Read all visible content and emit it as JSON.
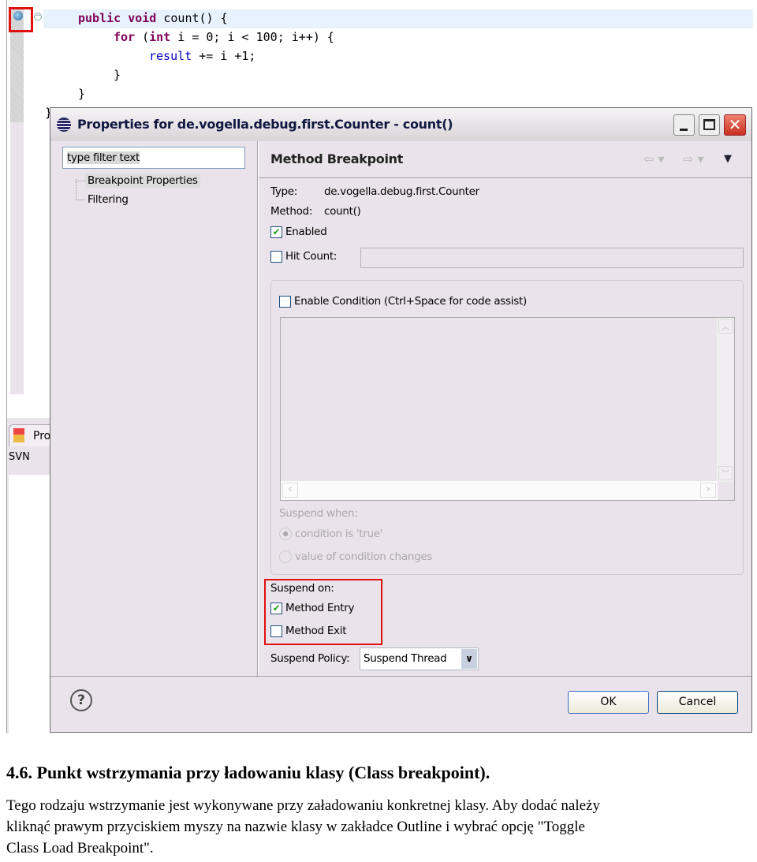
{
  "editor": {
    "lines": [
      {
        "parts": [
          {
            "t": "public",
            "k": "kw"
          },
          {
            "t": " "
          },
          {
            "t": "void",
            "k": "kw"
          },
          {
            "t": " count() {"
          }
        ]
      },
      {
        "parts": [
          {
            "t": "for",
            "k": "kw"
          },
          {
            "t": " ("
          },
          {
            "t": "int",
            "k": "kw"
          },
          {
            "t": " i = 0; i < 100; i++) {"
          }
        ]
      },
      {
        "parts": [
          {
            "t": "result",
            "k": "fld"
          },
          {
            "t": " += i +1;"
          }
        ]
      },
      {
        "parts": [
          {
            "t": "}"
          }
        ]
      },
      {
        "parts": [
          {
            "t": "}"
          }
        ]
      },
      {
        "parts": [
          {
            "t": "}"
          }
        ]
      }
    ],
    "breakpoint_icon": "method-breakpoint-icon"
  },
  "side_view": {
    "tab_label": "Pro",
    "svn_label": "SVN"
  },
  "dialog": {
    "title": "Properties for de.vogella.debug.first.Counter - count()",
    "filter_placeholder": "type filter text",
    "tree": [
      "Breakpoint Properties",
      "Filtering"
    ],
    "page_title": "Method Breakpoint",
    "type_label": "Type:",
    "type_value": "de.vogella.debug.first.Counter",
    "method_label": "Method:",
    "method_value": "count()",
    "enabled_label": "Enabled",
    "enabled": true,
    "hit_count_label": "Hit Count:",
    "hit_count": false,
    "hit_count_value": "",
    "enable_condition_label": "Enable Condition (Ctrl+Space for code assist)",
    "enable_condition": false,
    "suspend_when_label": "Suspend when:",
    "suspend_when_options": [
      "condition is 'true'",
      "value of condition changes"
    ],
    "suspend_on_label": "Suspend on:",
    "method_entry_label": "Method Entry",
    "method_entry": true,
    "method_exit_label": "Method Exit",
    "method_exit": false,
    "suspend_policy_label": "Suspend Policy:",
    "suspend_policy_value": "Suspend Thread",
    "ok_label": "OK",
    "cancel_label": "Cancel",
    "highlight_color": "#e01010"
  },
  "doc": {
    "heading": "4.6.  Punkt wstrzymania przy ładowaniu klasy (Class breakpoint).",
    "lines": [
      "Tego rodzaju wstrzymanie jest wykonywane przy załadowaniu konkretnej klasy. Aby dodać należy",
      "kliknąć prawym przyciskiem myszy na nazwie klasy w zakładce Outline i wybrać opcję \"Toggle",
      "Class Load Breakpoint\"."
    ]
  }
}
